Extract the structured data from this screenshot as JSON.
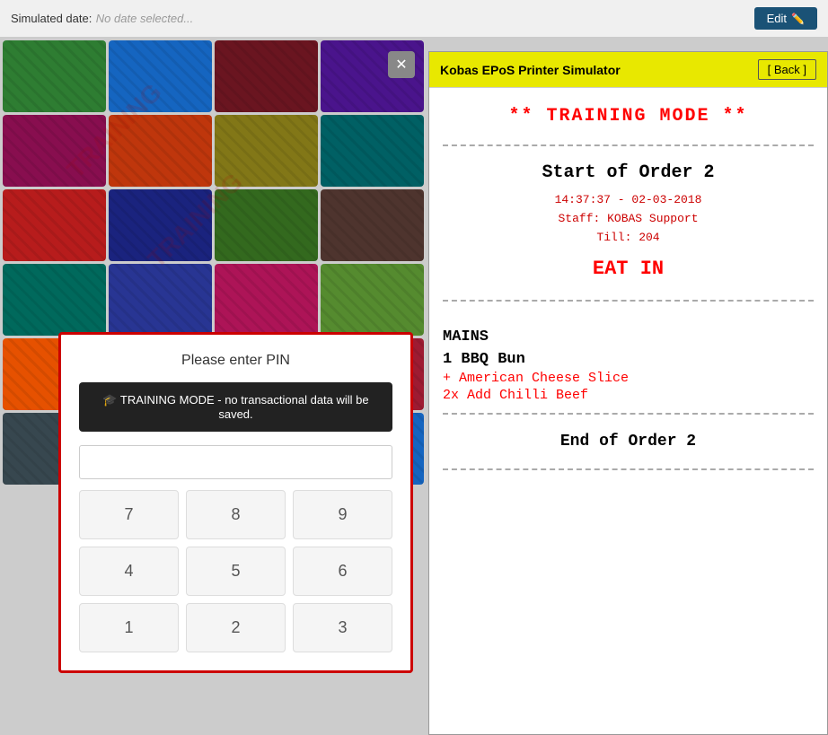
{
  "topBar": {
    "simulatedDateLabel": "Simulated date:",
    "simulatedDateValue": "No date selected...",
    "editButtonLabel": "Edit"
  },
  "closeButton": {
    "symbol": "✕"
  },
  "pinModal": {
    "title": "Please enter PIN",
    "trainingBanner": "🎓  TRAINING MODE - no transactional data will be saved.",
    "inputPlaceholder": "",
    "keys": [
      "7",
      "8",
      "9",
      "4",
      "5",
      "6",
      "1",
      "2",
      "3"
    ]
  },
  "printerPanel": {
    "title": "Kobas EPoS Printer Simulator",
    "backButtonLabel": "[ Back ]",
    "trainingModeText": "**  TRAINING MODE  **",
    "orderTitle": "Start of Order 2",
    "orderTime": "14:37:37 - 02-03-2018",
    "staffLabel": "Staff: KOBAS Support",
    "tillLabel": "Till: 204",
    "eatInText": "EAT IN",
    "sectionLabel": "MAINS",
    "items": [
      {
        "name": "1  BBQ Bun",
        "addons": [
          "+ American Cheese Slice",
          "2x Add Chilli Beef"
        ]
      }
    ],
    "endOrderText": "End of Order 2"
  },
  "tiles": [
    {
      "color": "#2e7d32",
      "label": ""
    },
    {
      "color": "#1565c0",
      "label": ""
    },
    {
      "color": "#6a1520",
      "label": ""
    },
    {
      "color": "#4a148c",
      "label": ""
    },
    {
      "color": "#880e4f",
      "label": ""
    },
    {
      "color": "#bf360c",
      "label": ""
    },
    {
      "color": "#827717",
      "label": ""
    },
    {
      "color": "#006064",
      "label": ""
    },
    {
      "color": "#b71c1c",
      "label": ""
    },
    {
      "color": "#1a237e",
      "label": ""
    },
    {
      "color": "#33691e",
      "label": ""
    },
    {
      "color": "#4e342e",
      "label": ""
    },
    {
      "color": "#00695c",
      "label": ""
    },
    {
      "color": "#283593",
      "label": ""
    },
    {
      "color": "#ad1457",
      "label": ""
    },
    {
      "color": "#558b2f",
      "label": ""
    },
    {
      "color": "#e65100",
      "label": ""
    },
    {
      "color": "#5d4037",
      "label": ""
    },
    {
      "color": "#0277bd",
      "label": ""
    },
    {
      "color": "#9e1b32",
      "label": ""
    },
    {
      "color": "#37474f",
      "label": ""
    },
    {
      "color": "#2e7d32",
      "label": ""
    },
    {
      "color": "#6a1520",
      "label": ""
    },
    {
      "color": "#1565c0",
      "label": ""
    }
  ]
}
